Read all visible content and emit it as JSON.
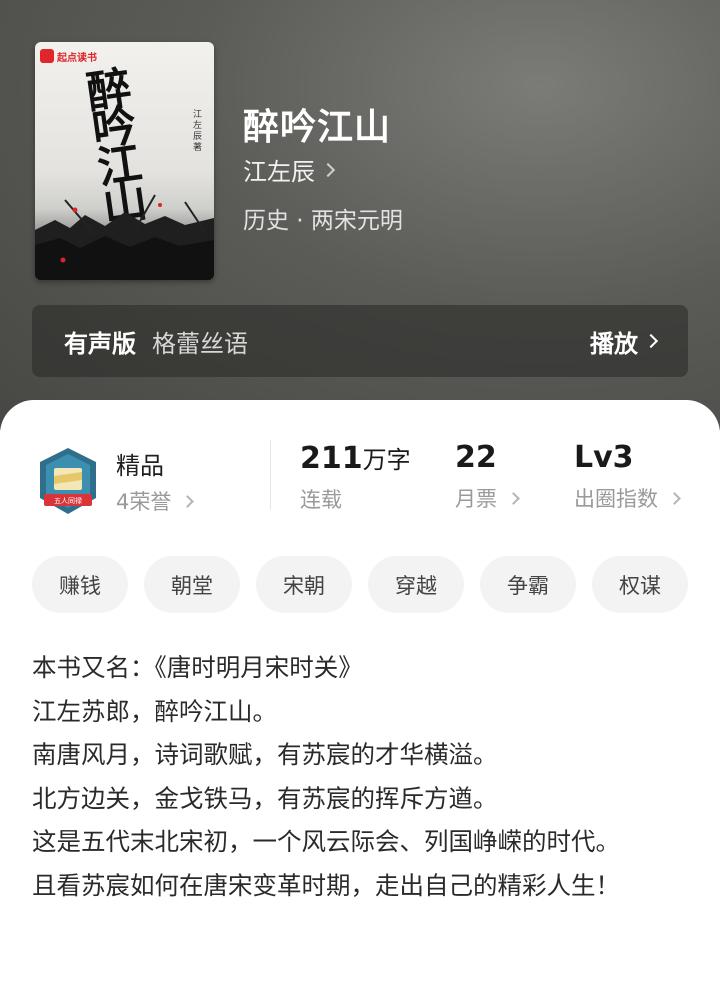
{
  "book": {
    "cover_brand": "起点读书",
    "cover_title": "醉吟江山",
    "cover_author": "江左辰 著",
    "title": "醉吟江山",
    "author": "江左辰",
    "category": "历史 · 两宋元明"
  },
  "audio": {
    "label": "有声版",
    "narrator": "格蕾丝语",
    "play_label": "播放"
  },
  "stats": {
    "quality": {
      "title": "精品",
      "honors": "4荣誉",
      "emblem_text": "五人同禄"
    },
    "words": {
      "value": "211",
      "unit": "万字",
      "status": "连载"
    },
    "monthly_votes": {
      "value": "22",
      "label": "月票"
    },
    "circle_index": {
      "value": "Lv3",
      "label": "出圈指数"
    }
  },
  "tags": [
    "赚钱",
    "朝堂",
    "宋朝",
    "穿越",
    "争霸",
    "权谋"
  ],
  "description": [
    "本书又名：《唐时明月宋时关》",
    "江左苏郎，醉吟江山。",
    "南唐风月，诗词歌赋，有苏宸的才华横溢。",
    "北方边关，金戈铁马，有苏宸的挥斥方遒。",
    "这是五代末北宋初，一个风云际会、列国峥嵘的时代。",
    "且看苏宸如何在唐宋变革时期，走出自己的精彩人生！"
  ],
  "colors": {
    "accent_red": "#e0262b",
    "hero_bg": "#5b5b57"
  }
}
